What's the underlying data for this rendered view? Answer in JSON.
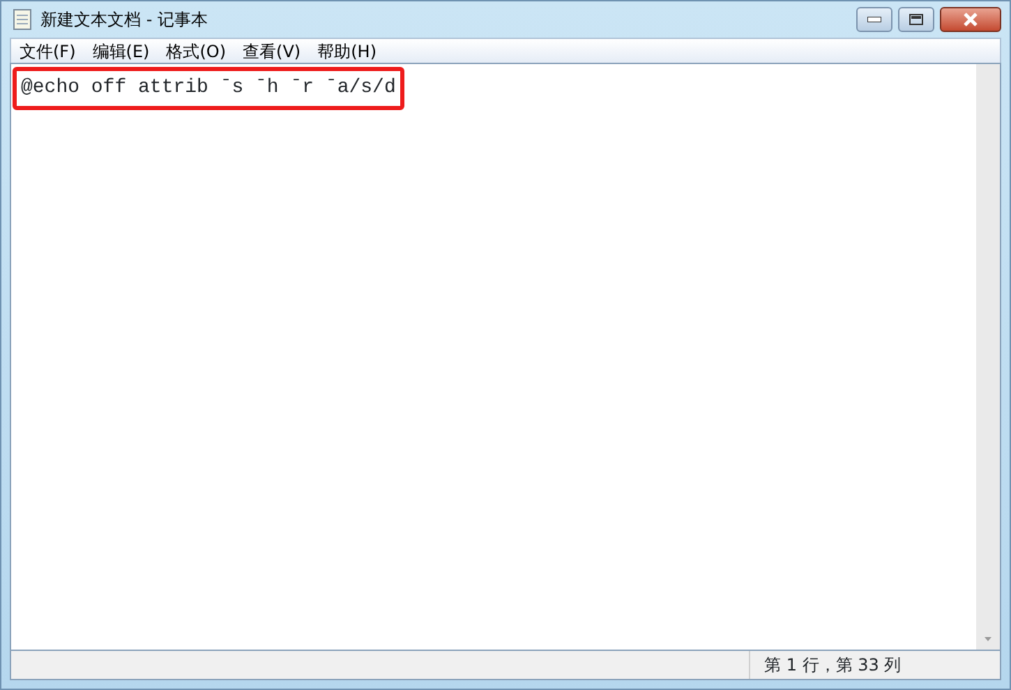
{
  "window": {
    "title": "新建文本文档 - 记事本"
  },
  "menu": [
    {
      "label": "文件(F)"
    },
    {
      "label": "编辑(E)"
    },
    {
      "label": "格式(O)"
    },
    {
      "label": "查看(V)"
    },
    {
      "label": "帮助(H)"
    }
  ],
  "editor": {
    "text": "@echo off attrib ˉs ˉh ˉr ˉa/s/d",
    "highlighted": true
  },
  "status_bar": {
    "position": "第 1 行，第 33 列"
  }
}
